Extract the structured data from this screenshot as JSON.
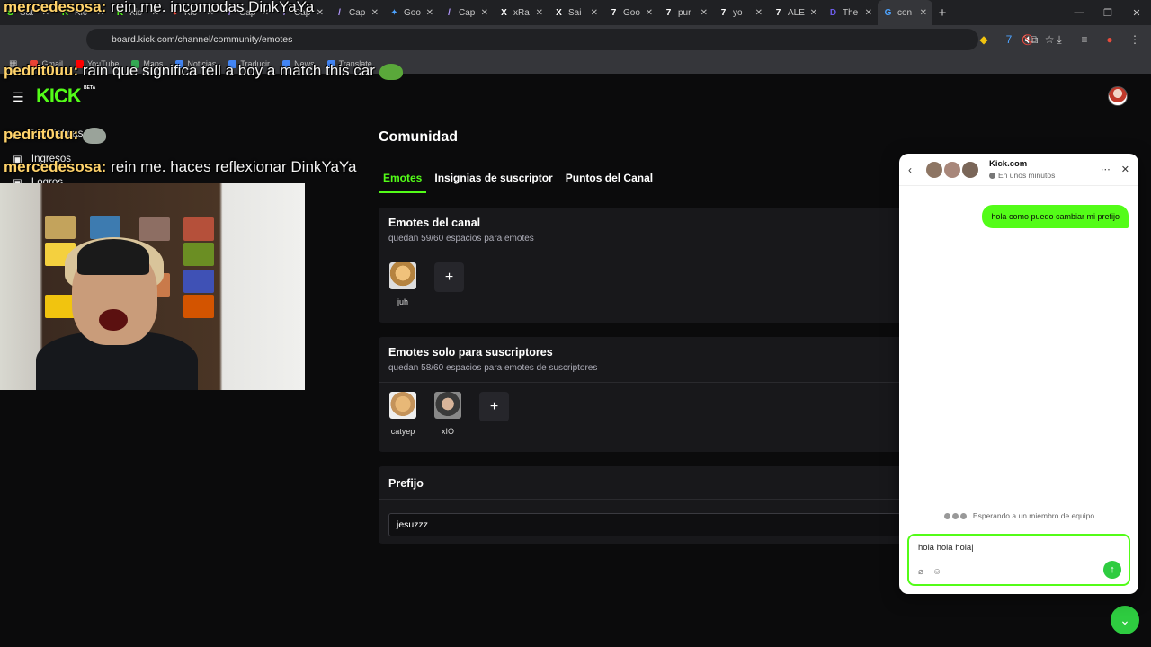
{
  "browser": {
    "tabs": [
      {
        "title": "Sat",
        "fav_color": "#53fc18",
        "fav": "S"
      },
      {
        "title": "Kic",
        "fav_color": "#53fc18",
        "fav": "K"
      },
      {
        "title": "Kic",
        "fav_color": "#53fc18",
        "fav": "K"
      },
      {
        "title": "Kic",
        "fav_color": "#e74c3c",
        "fav": "●"
      },
      {
        "title": "Cap",
        "fav_color": "#b197fc",
        "fav": "/"
      },
      {
        "title": "Cap",
        "fav_color": "#b197fc",
        "fav": "/"
      },
      {
        "title": "Cap",
        "fav_color": "#b197fc",
        "fav": "/"
      },
      {
        "title": "Goo",
        "fav_color": "#4da3ff",
        "fav": "✦"
      },
      {
        "title": "Cap",
        "fav_color": "#b197fc",
        "fav": "/"
      },
      {
        "title": "xRa",
        "fav_color": "#ffffff",
        "fav": "X"
      },
      {
        "title": "Sai",
        "fav_color": "#ffffff",
        "fav": "X"
      },
      {
        "title": "Goo",
        "fav_color": "#ffffff",
        "fav": "7"
      },
      {
        "title": "pur",
        "fav_color": "#ffffff",
        "fav": "7"
      },
      {
        "title": "yo",
        "fav_color": "#ffffff",
        "fav": "7"
      },
      {
        "title": "ALE",
        "fav_color": "#ffffff",
        "fav": "7"
      },
      {
        "title": "The",
        "fav_color": "#6c5ce7",
        "fav": "D"
      },
      {
        "title": "con",
        "fav_color": "#4da3ff",
        "fav": "G",
        "active": true
      }
    ],
    "new_tab": "+",
    "url": "board.kick.com/channel/community/emotes",
    "bookmarks": [
      {
        "label": "Gmail",
        "color": "#ea4335"
      },
      {
        "label": "YouTube",
        "color": "#ff0000"
      },
      {
        "label": "Maps",
        "color": "#34a853"
      },
      {
        "label": "Noticias",
        "color": "#4285f4"
      },
      {
        "label": "Traducir",
        "color": "#4285f4"
      },
      {
        "label": "News",
        "color": "#4285f4"
      },
      {
        "label": "Translate",
        "color": "#4285f4"
      }
    ]
  },
  "sidebar": {
    "logo": "KICK",
    "logo_badge": "BETA",
    "items": [
      {
        "label": "Estadísticas"
      },
      {
        "label": "Ingresos"
      },
      {
        "label": "Logros"
      }
    ]
  },
  "main": {
    "title": "Comunidad",
    "tabs": [
      "Emotes",
      "Insignias de suscriptor",
      "Puntos del Canal"
    ],
    "active_tab": 0,
    "channel_emotes": {
      "title": "Emotes del canal",
      "subtitle": "quedan 59/60 espacios para emotes",
      "emotes": [
        {
          "name": "juh"
        }
      ]
    },
    "sub_emotes": {
      "title": "Emotes solo para suscriptores",
      "subtitle": "quedan 58/60 espacios para emotes de suscriptores",
      "emotes": [
        {
          "name": "catyep"
        },
        {
          "name": "xIO"
        }
      ]
    },
    "prefix": {
      "title": "Prefijo",
      "value": "jesuzzz"
    }
  },
  "overlay_chat": [
    {
      "user": "mercedesosa:",
      "msg": "rein me. incomodas DinkYaYa"
    },
    {
      "user": "pedrit0uu:",
      "msg": "rain que significa tell a boy a match this car"
    },
    {
      "user": "pedrit0uu:",
      "msg": ""
    },
    {
      "user": "mercedesosa:",
      "msg": "rein me. haces reflexionar DinkYaYa"
    }
  ],
  "support_chat": {
    "brand": "Kick.com",
    "status": "En unos minutos",
    "message_out": "hola como puedo cambiar mi prefijo",
    "waiting": "Esperando a un miembro de equipo",
    "draft": "hola hola hola"
  }
}
